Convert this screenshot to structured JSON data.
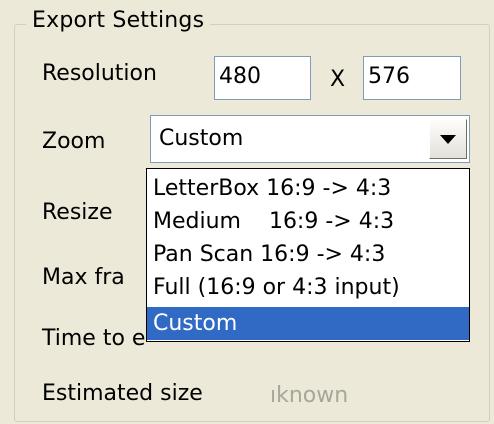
{
  "group": {
    "title": "Export Settings"
  },
  "resolution": {
    "label": "Resolution",
    "width": "480",
    "sep": "X",
    "height": "576"
  },
  "zoom": {
    "label": "Zoom",
    "selected": "Custom",
    "options": [
      "LetterBox 16:9 -> 4:3",
      "Medium    16:9 -> 4:3",
      "Pan Scan 16:9 -> 4:3",
      "Full (16:9 or 4:3 input)",
      "Custom"
    ],
    "highlighted_index": 4
  },
  "resize": {
    "label": "Resize"
  },
  "max_frame": {
    "label": "Max fra"
  },
  "time_to_encode": {
    "label": "Time to e"
  },
  "estimated_size": {
    "label": "Estimated size",
    "value": "ıknown"
  }
}
